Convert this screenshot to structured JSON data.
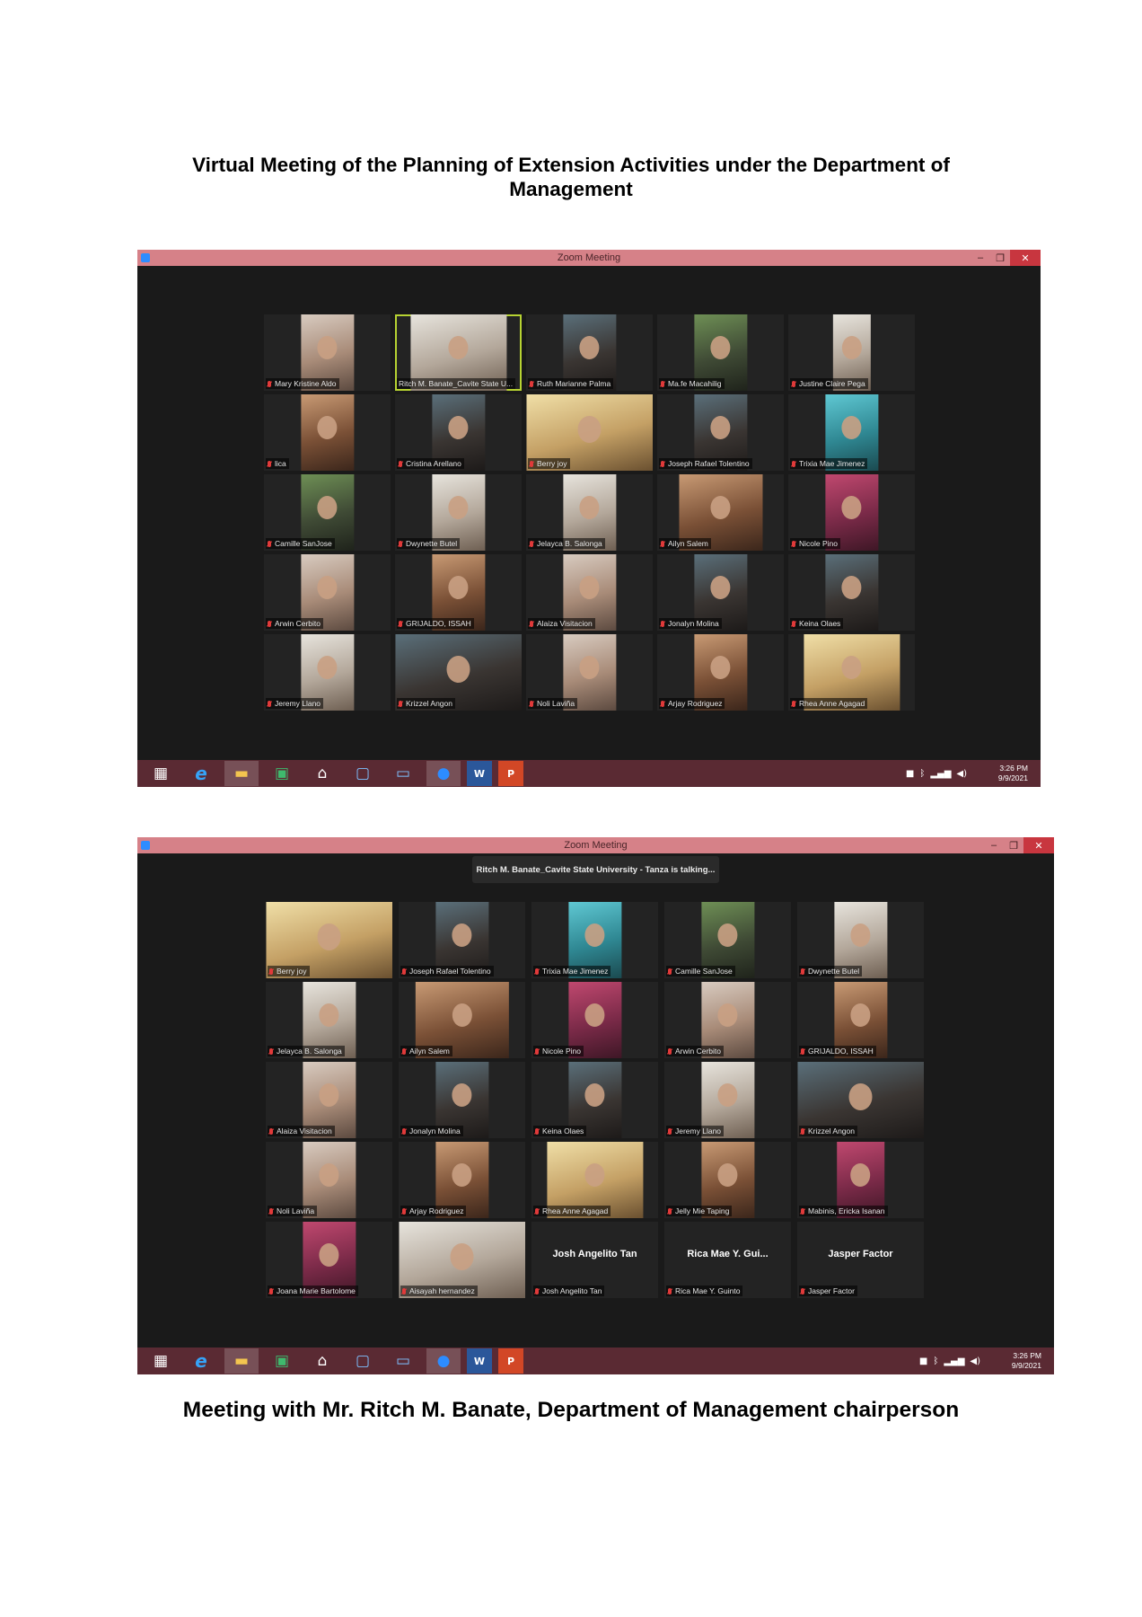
{
  "document": {
    "title": "Virtual Meeting of the Planning of Extension Activities under the Department of Management",
    "caption": "Meeting with Mr. Ritch M. Banate, Department of Management chairperson"
  },
  "screenshot1": {
    "window_title": "Zoom Meeting",
    "participants": [
      "Mary Kristine Aldo",
      "Ritch M. Banate_Cavite State U...",
      "Ruth Marianne Palma",
      "Ma.fe Macahilig",
      "Justine Claire Pega",
      "lica",
      "Cristina Arellano",
      "Berry joy",
      "Joseph Rafael Tolentino",
      "Trixia Mae Jimenez",
      "Camille SanJose",
      "Dwynette Butel",
      "Jelayca B. Salonga",
      "Ailyn Salem",
      "Nicole Pino",
      "Arwin Cerbito",
      "GRIJALDO, ISSAH",
      "Alaiza Visitacion",
      "Jonalyn Molina",
      "Keina Olaes",
      "Jeremy Llano",
      "Krizzel Angon",
      "Noli Laviña",
      "Arjay Rodriguez",
      "Rhea Anne Agagad"
    ],
    "clock": {
      "time": "3:26 PM",
      "date": "9/9/2021"
    }
  },
  "screenshot2": {
    "window_title": "Zoom Meeting",
    "talking_banner": "Ritch M. Banate_Cavite State University - Tanza is talking...",
    "participants": [
      "Berry joy",
      "Joseph Rafael Tolentino",
      "Trixia Mae Jimenez",
      "Camille SanJose",
      "Dwynette Butel",
      "Jelayca B. Salonga",
      "Ailyn Salem",
      "Nicole Pino",
      "Arwin Cerbito",
      "GRIJALDO, ISSAH",
      "Alaiza Visitacion",
      "Jonalyn Molina",
      "Keina Olaes",
      "Jeremy Llano",
      "Krizzel Angon",
      "Noli Laviña",
      "Arjay Rodriguez",
      "Rhea Anne Agagad",
      "Jelly Mie Taping",
      "Mabinis, Ericka Isanan",
      "Joana Marie Bartolome",
      "Aisayah hernandez",
      "Josh Angelito Tan",
      "Rica Mae Y. Guinto",
      "Jasper Factor"
    ],
    "camera_off_names": [
      "Josh Angelito Tan",
      "Rica Mae Y. Gui...",
      "Jasper Factor"
    ],
    "clock": {
      "time": "3:26 PM",
      "date": "9/9/2021"
    }
  },
  "colors": {
    "titlebar": "#d68188",
    "meeting_background": "#1a1a1a",
    "taskbar": "#5a2a33",
    "active_speaker_border": "#b7d332"
  },
  "icons": {
    "taskbar": [
      "windows-start-icon",
      "internet-explorer-icon",
      "file-explorer-icon",
      "store-icon",
      "home-icon",
      "this-pc-icon",
      "computer-icon",
      "zoom-icon",
      "word-icon",
      "powerpoint-icon"
    ],
    "tray": [
      "zoom-tray-icon",
      "bluetooth-icon",
      "network-icon",
      "volume-icon"
    ]
  }
}
